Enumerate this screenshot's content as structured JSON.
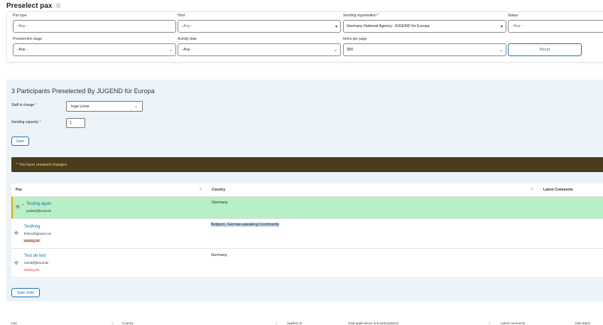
{
  "page": {
    "title": "Preselect pax"
  },
  "filters": {
    "pax_type": {
      "label": "Pax type",
      "value": "- Any -"
    },
    "host": {
      "label": "Host",
      "value": "- Any -"
    },
    "sending_org": {
      "label": "Sending organisation",
      "required": "*",
      "value": "Germany National Agency: JUGEND für Europa"
    },
    "status": {
      "label": "Status",
      "value": "- Any -"
    },
    "preselection_stage": {
      "label": "Preselection stage",
      "value": "- Any -"
    },
    "activity_date": {
      "label": "Activity date",
      "value": "- Any -"
    },
    "items_per_page": {
      "label": "Items per page",
      "value": "300"
    },
    "reset_label": "Reset"
  },
  "panel": {
    "title": "3 Participants Preselected By JUGEND für Europa",
    "staff_label": "Staff in charge",
    "staff_value": "Inge Linne",
    "capacity_label": "Sending capacity",
    "capacity_value": "1",
    "required": "*",
    "save_label": "Save",
    "warning": "* You have unsaved changes.",
    "save_order_label": "Save order"
  },
  "table": {
    "headers": {
      "pax": "Pax",
      "country": "Country",
      "comments": "Latest Comments"
    },
    "rows": [
      {
        "name": "Testing again",
        "email": "padlet@jfemal.de",
        "badge": "",
        "country": "Germany"
      },
      {
        "name": "Testhing",
        "email": "firdevs@gmail.com",
        "badge": "Waiting list",
        "country": "Belgium, German-speaking Community"
      },
      {
        "name": "Test de test",
        "email": "mentt@jfemal.de",
        "badge": "Waiting list",
        "country": "Germany"
      }
    ]
  },
  "bottom_headers": [
    "Pax",
    "Country",
    "Applied on",
    "Total applications and participations",
    "Latest comments",
    "Edit status"
  ],
  "icons": {
    "star": "star-outline-icon",
    "drag": "drag-handle-icon",
    "sort": "sort-icon",
    "chevron": "chevron-down-icon"
  }
}
